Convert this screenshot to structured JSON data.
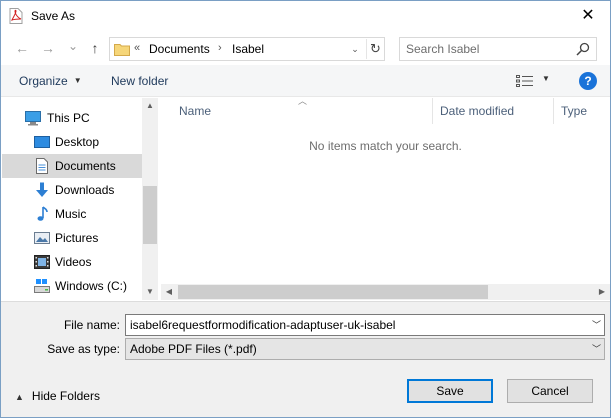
{
  "window": {
    "title": "Save As",
    "close_glyph": "✕"
  },
  "navigation": {
    "back_glyph": "←",
    "forward_glyph": "→",
    "recent_glyph": "⌄",
    "up_glyph": "↑",
    "address": {
      "overflow": "«",
      "crumbs": [
        "Documents",
        "Isabel"
      ],
      "separator": "›",
      "dropdown_glyph": "⌄",
      "refresh_glyph": "↻"
    },
    "search": {
      "placeholder": "Search Isabel"
    }
  },
  "toolbar": {
    "organize_label": "Organize",
    "new_folder_label": "New folder",
    "help_label": "?"
  },
  "tree": {
    "items": [
      {
        "label": "This PC",
        "icon": "computer-icon",
        "selected": false
      },
      {
        "label": "Desktop",
        "icon": "desktop-icon",
        "selected": false
      },
      {
        "label": "Documents",
        "icon": "documents-icon",
        "selected": true
      },
      {
        "label": "Downloads",
        "icon": "downloads-icon",
        "selected": false
      },
      {
        "label": "Music",
        "icon": "music-icon",
        "selected": false
      },
      {
        "label": "Pictures",
        "icon": "pictures-icon",
        "selected": false
      },
      {
        "label": "Videos",
        "icon": "videos-icon",
        "selected": false
      },
      {
        "label": "Windows (C:)",
        "icon": "drive-icon",
        "selected": false
      }
    ]
  },
  "file_list": {
    "columns": [
      "Name",
      "Date modified",
      "Type"
    ],
    "empty_message": "No items match your search."
  },
  "form": {
    "filename_label": "File name:",
    "filename_value": "isabel6requestformodification-adaptuser-uk-isabel",
    "type_label": "Save as type:",
    "type_value": "Adobe PDF Files (*.pdf)"
  },
  "buttons": {
    "hide_folders_label": "Hide Folders",
    "save_label": "Save",
    "cancel_label": "Cancel"
  },
  "colors": {
    "accent": "#0078d7",
    "help_blue": "#1a73d9",
    "selected_item": "#d9d9d9",
    "header_text": "#4c607a",
    "footer_bg": "#f0f0f0"
  }
}
